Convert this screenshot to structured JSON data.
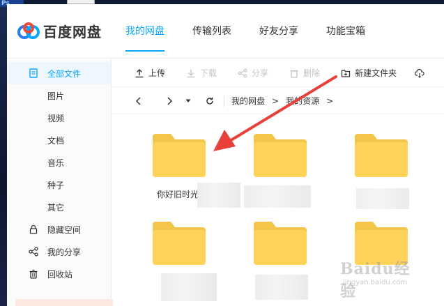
{
  "app": {
    "name": "百度网盘",
    "brand_color": "#06a7ff"
  },
  "nav": {
    "tabs": [
      {
        "label": "我的网盘",
        "active": true
      },
      {
        "label": "传输列表",
        "active": false
      },
      {
        "label": "好友分享",
        "active": false
      },
      {
        "label": "功能宝箱",
        "active": false
      }
    ]
  },
  "sidebar": {
    "items": [
      {
        "label": "全部文件",
        "icon": "document-icon",
        "active": true
      },
      {
        "label": "图片"
      },
      {
        "label": "视频"
      },
      {
        "label": "文档"
      },
      {
        "label": "音乐"
      },
      {
        "label": "种子"
      },
      {
        "label": "其它"
      },
      {
        "label": "隐藏空间",
        "icon": "lock-icon"
      },
      {
        "label": "我的分享",
        "icon": "share-icon"
      },
      {
        "label": "回收站",
        "icon": "trash-icon"
      }
    ]
  },
  "toolbar": {
    "upload": "上传",
    "download": "下载",
    "share": "分享",
    "delete": "删除",
    "new_folder": "新建文件夹"
  },
  "breadcrumb": {
    "items": [
      "我的网盘",
      "我的资源"
    ]
  },
  "folders": [
    {
      "name": "你好旧时光"
    },
    {
      "name": ""
    },
    {
      "name": ""
    },
    {
      "name": ""
    },
    {
      "name": ""
    },
    {
      "name": ""
    }
  ],
  "watermark": {
    "main": "Baidu经验",
    "sub": "jingyan.baidu.com"
  },
  "colors": {
    "folder_body": "#ffd359",
    "folder_tab": "#f3c64a",
    "annotation": "#e8403a",
    "active_bg": "#eef7ff"
  }
}
